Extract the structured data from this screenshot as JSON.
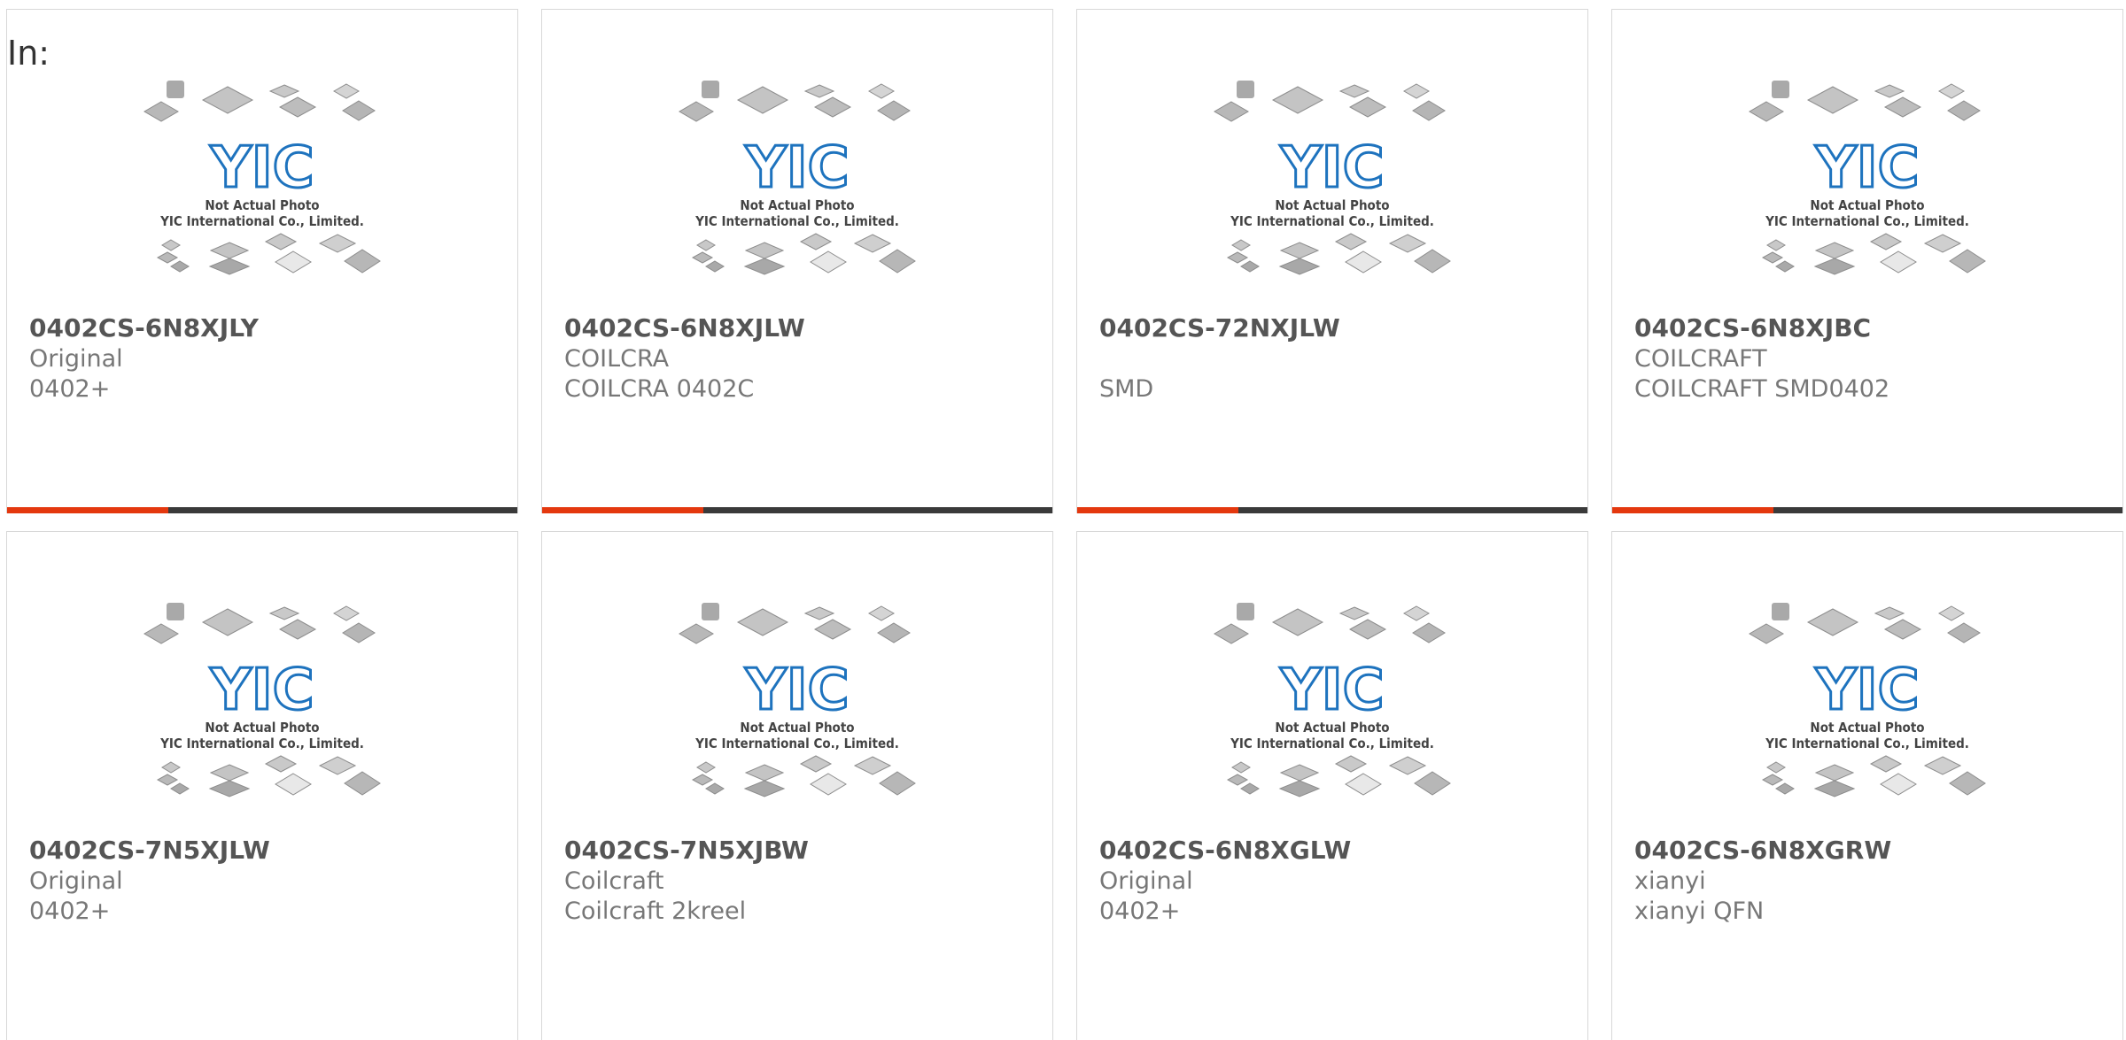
{
  "header": {
    "in_label": "In:"
  },
  "photo": {
    "caption_line1": "Not Actual Photo",
    "caption_line2": "YIC International Co., Limited.",
    "logo_text": "YIC"
  },
  "colors": {
    "accent": "#e4380e",
    "bar": "#3a3a3a",
    "logo": "#1e73be"
  },
  "products": [
    {
      "part": "0402CS-6N8XJLY",
      "brand": "Original",
      "package": "0402+"
    },
    {
      "part": "0402CS-6N8XJLW",
      "brand": "COILCRA",
      "package": "COILCRA 0402C"
    },
    {
      "part": "0402CS-72NXJLW",
      "brand": "",
      "package": "SMD"
    },
    {
      "part": "0402CS-6N8XJBC",
      "brand": "COILCRAFT",
      "package": "COILCRAFT SMD0402"
    },
    {
      "part": "0402CS-7N5XJLW",
      "brand": "Original",
      "package": "0402+"
    },
    {
      "part": "0402CS-7N5XJBW",
      "brand": "Coilcraft",
      "package": "Coilcraft 2kreel"
    },
    {
      "part": "0402CS-6N8XGLW",
      "brand": "Original",
      "package": "0402+"
    },
    {
      "part": "0402CS-6N8XGRW",
      "brand": "xianyi",
      "package": "xianyi QFN"
    }
  ]
}
